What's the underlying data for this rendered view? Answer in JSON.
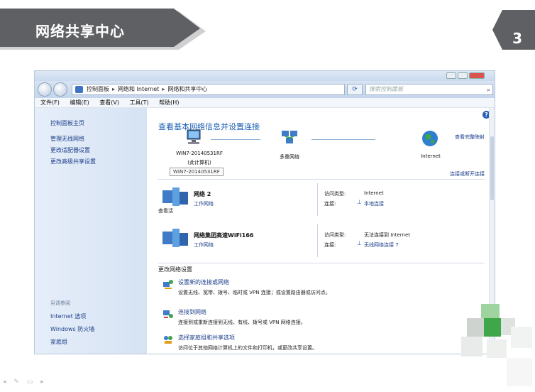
{
  "slide": {
    "title": "网络共享中心",
    "page_number": "3"
  },
  "window": {
    "address": {
      "root": "控制面板",
      "level2": "网络和 Internet",
      "level3": "网络和共享中心"
    },
    "search_placeholder": "搜索控制面板",
    "menu": [
      "文件(F)",
      "编辑(E)",
      "查看(V)",
      "工具(T)",
      "帮助(H)"
    ],
    "sidebar": {
      "links": [
        "控制面板主页",
        "管理无线网络",
        "更改适配器设置",
        "更改高级共享设置"
      ],
      "see_also_title": "另请参阅",
      "see_also": [
        "Internet 选项",
        "Windows 防火墙",
        "家庭组"
      ]
    },
    "main": {
      "heading": "查看基本网络信息并设置连接",
      "view_full_map": "查看完整映射",
      "nodes": {
        "computer": "WIN7-20140531RF",
        "computer_sub": "(此计算机)",
        "multi": "多重网络",
        "internet": "Internet"
      },
      "tooltip": "WIN7-20140531RF",
      "active_networks_title": "查看活",
      "connect_disconnect": "连接或断开连接",
      "networks": [
        {
          "name": "网络  2",
          "type": "工作网络",
          "access_label": "访问类型:",
          "access_value": "Internet",
          "conn_label": "连接:",
          "conn_value": "本地连接"
        },
        {
          "name": "网络集团高速WiFi166",
          "type": "工作网络",
          "access_label": "访问类型:",
          "access_value": "无法连接到 Internet",
          "conn_label": "连接:",
          "conn_value": "无线网络连接 7"
        }
      ],
      "change_settings_title": "更改网络设置",
      "tasks": [
        {
          "link": "设置新的连接或网络",
          "desc": "设置无线、宽带、拨号、临时或 VPN 连接；或设置路由器或访问点。"
        },
        {
          "link": "连接到网络",
          "desc": "连接到或重新连接到无线、有线、拨号或 VPN 网络连接。"
        },
        {
          "link": "选择家庭组和共享选项",
          "desc": "访问位于其他网络计算机上的文件和打印机，或更改共享设置。"
        }
      ]
    }
  },
  "colors": {
    "banner": "#5f6063",
    "link": "#1c3f8a",
    "heading": "#1b5fb5",
    "sidebar_bg": "#dce7f6",
    "accent_green": "#3fa64a"
  }
}
